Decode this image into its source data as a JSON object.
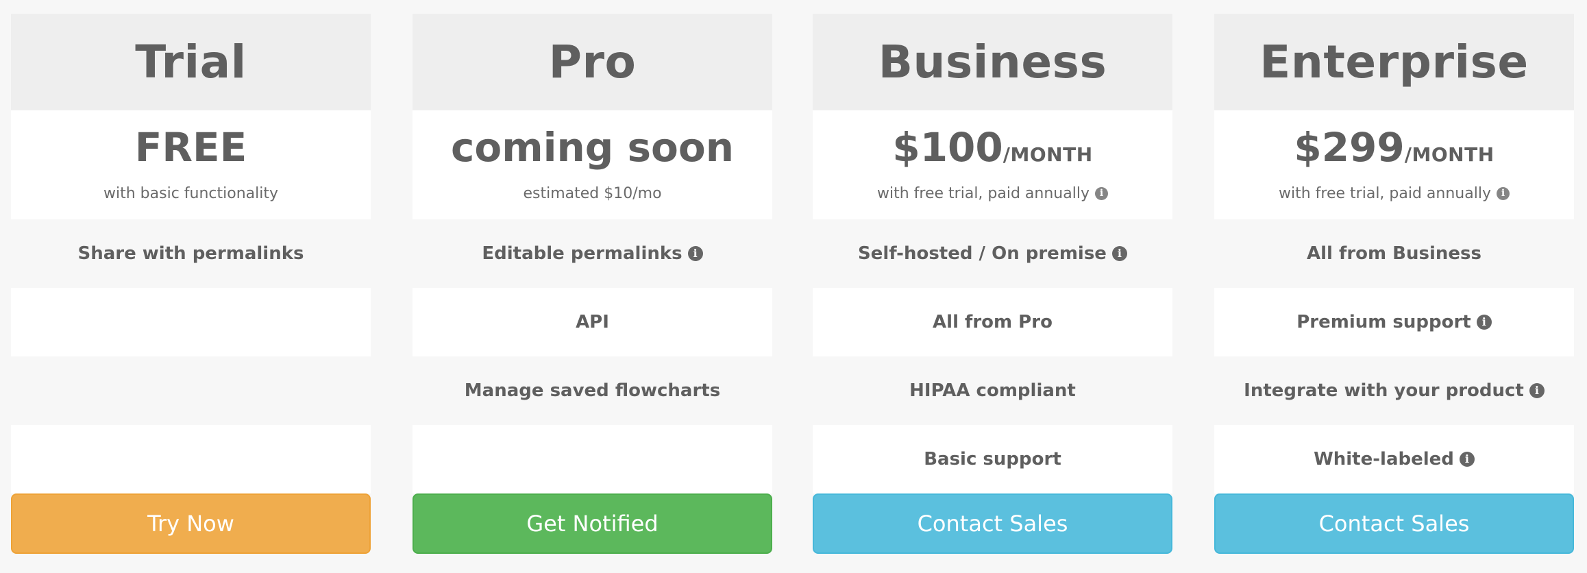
{
  "colors": {
    "orange": "#f0ad4e",
    "orange_border": "#eea236",
    "green": "#5cb85c",
    "green_border": "#4cae4c",
    "blue": "#5bc0de",
    "blue_border": "#46b8da"
  },
  "plans": [
    {
      "name": "Trial",
      "price": "FREE",
      "unit": "",
      "note": "with basic functionality",
      "features": [
        "Share with permalinks",
        "",
        "",
        ""
      ],
      "cta": "Try Now",
      "cta_color": "orange"
    },
    {
      "name": "Pro",
      "price": "coming soon",
      "unit": "",
      "note": "estimated $10/mo",
      "features": [
        "Editable permalinks",
        "API",
        "Manage saved flowcharts",
        ""
      ],
      "cta": "Get Notified",
      "cta_color": "green"
    },
    {
      "name": "Business",
      "price": "$100",
      "unit": "/MONTH",
      "note": "with free trial, paid annually",
      "features": [
        "Self-hosted / On premise",
        "All from Pro",
        "HIPAA compliant",
        "Basic support"
      ],
      "cta": "Contact Sales",
      "cta_color": "blue"
    },
    {
      "name": "Enterprise",
      "price": "$299",
      "unit": "/MONTH",
      "note": "with free trial, paid annually",
      "features": [
        "All from Business",
        "Premium support",
        "Integrate with your product",
        "White-labeled"
      ],
      "cta": "Contact Sales",
      "cta_color": "blue"
    }
  ]
}
